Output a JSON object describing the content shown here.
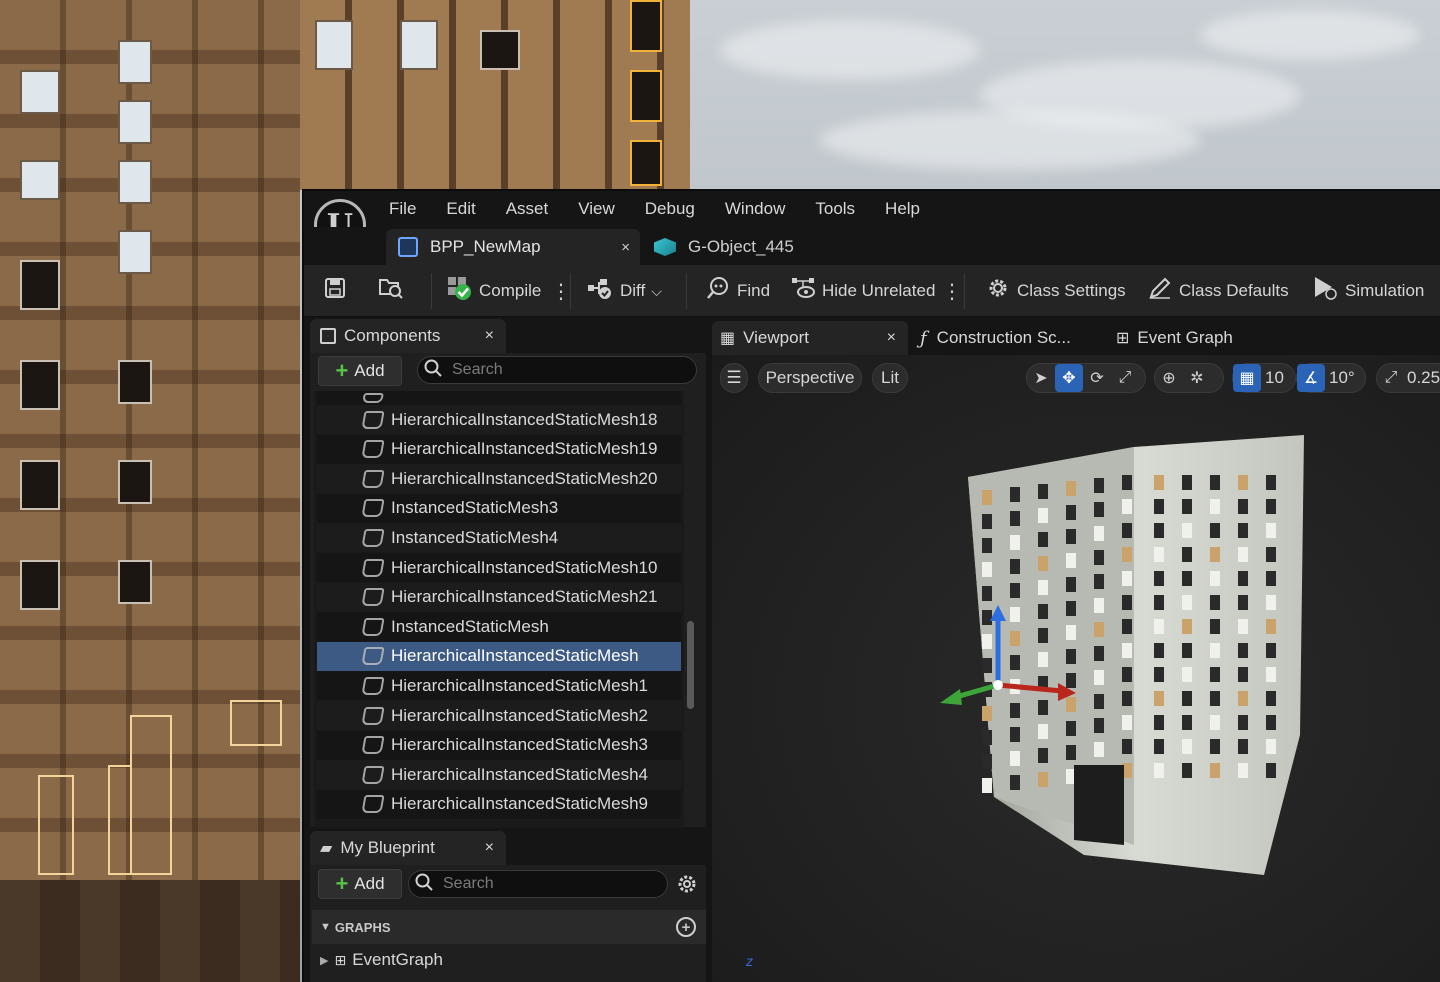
{
  "menu": [
    "File",
    "Edit",
    "Asset",
    "View",
    "Debug",
    "Window",
    "Tools",
    "Help"
  ],
  "document_tabs": {
    "active": {
      "label": "BPP_NewMap",
      "close": "×"
    },
    "inactive": {
      "label": "G-Object_445"
    }
  },
  "toolbar": {
    "compile": "Compile",
    "diff": "Diff",
    "find": "Find",
    "hide_unrelated": "Hide Unrelated",
    "class_settings": "Class Settings",
    "class_defaults": "Class Defaults",
    "simulation": "Simulation"
  },
  "components_panel": {
    "title": "Components",
    "close": "×",
    "add_label": "Add",
    "search_placeholder": "Search",
    "items": [
      {
        "label": "HierarchicalInstancedStaticMesh18",
        "selected": false
      },
      {
        "label": "HierarchicalInstancedStaticMesh19",
        "selected": false
      },
      {
        "label": "HierarchicalInstancedStaticMesh20",
        "selected": false
      },
      {
        "label": "InstancedStaticMesh3",
        "selected": false
      },
      {
        "label": "InstancedStaticMesh4",
        "selected": false
      },
      {
        "label": "HierarchicalInstancedStaticMesh10",
        "selected": false
      },
      {
        "label": "HierarchicalInstancedStaticMesh21",
        "selected": false
      },
      {
        "label": "InstancedStaticMesh",
        "selected": false
      },
      {
        "label": "HierarchicalInstancedStaticMesh",
        "selected": true
      },
      {
        "label": "HierarchicalInstancedStaticMesh1",
        "selected": false
      },
      {
        "label": "HierarchicalInstancedStaticMesh2",
        "selected": false
      },
      {
        "label": "HierarchicalInstancedStaticMesh3",
        "selected": false
      },
      {
        "label": "HierarchicalInstancedStaticMesh4",
        "selected": false
      },
      {
        "label": "HierarchicalInstancedStaticMesh9",
        "selected": false
      }
    ]
  },
  "my_blueprint_panel": {
    "title": "My Blueprint",
    "close": "×",
    "add_label": "Add",
    "search_placeholder": "Search",
    "graphs_header": "GRAPHS",
    "graphs": [
      "EventGraph"
    ]
  },
  "viewport_tabs": {
    "viewport": "Viewport",
    "viewport_close": "×",
    "construction": "Construction Sc...",
    "event_graph": "Event Graph"
  },
  "viewport_toolbar": {
    "perspective": "Perspective",
    "lit": "Lit",
    "grid_snap": "10",
    "rotation_snap": "10°",
    "scale_snap": "0.25"
  },
  "colors": {
    "accent": "#2b63b6",
    "selection": "#3d5a85",
    "add_green": "#59c24a"
  }
}
